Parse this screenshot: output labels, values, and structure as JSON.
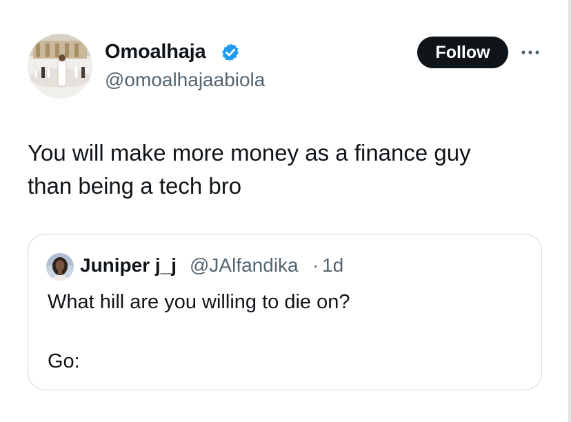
{
  "author": {
    "display_name": "Omoalhaja",
    "handle": "@omoalhajaabiola",
    "verified": true,
    "avatar_icon": "mosque-courtyard-photo"
  },
  "header": {
    "follow_label": "Follow",
    "more_icon": "more-horizontal-icon"
  },
  "tweet": {
    "lines": [
      "You will make more money as a finance guy",
      "than being a tech bro"
    ]
  },
  "quote": {
    "display_name": "Juniper j_j",
    "handle": "@JAlfandika",
    "separator": "·",
    "time": "1d",
    "text_line1": "What hill are you willing to die on?",
    "text_line2": "Go:"
  },
  "colors": {
    "text": "#0f1419",
    "secondary": "#536471",
    "verified": "#1d9bf0",
    "button_bg": "#0f1419",
    "button_text": "#ffffff",
    "border": "#cfd9de"
  }
}
